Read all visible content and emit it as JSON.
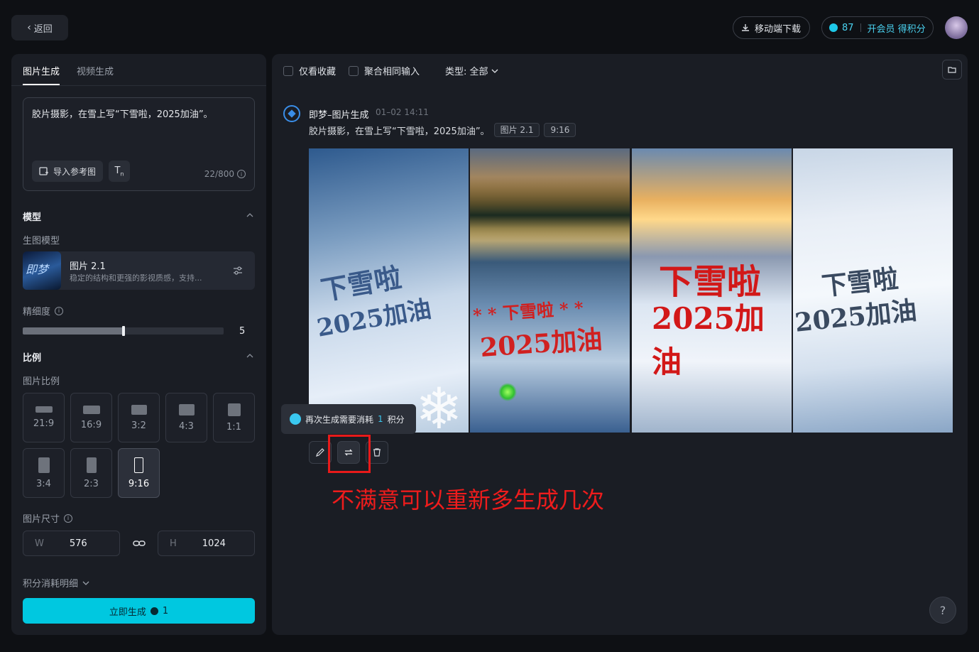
{
  "header": {
    "back_label": "返回",
    "mobile_download_label": "移动端下载",
    "points": "87",
    "member_label": "开会员 得积分"
  },
  "left_panel": {
    "tabs": [
      {
        "label": "图片生成",
        "active": true
      },
      {
        "label": "视频生成",
        "active": false
      }
    ],
    "prompt": "胶片摄影，在雪上写“下雪啦，2025加油”。",
    "import_ref_label": "导入参考图",
    "char_count": "22/800",
    "model_section": {
      "title": "模型",
      "sub_label": "生图模型",
      "model_name": "图片 2.1",
      "model_desc": "稳定的结构和更强的影视质感，支持...",
      "thumb_text": "即梦"
    },
    "detail": {
      "label": "精细度",
      "value": "5",
      "level": 0.5
    },
    "ratio_section": {
      "title": "比例",
      "sub_label": "图片比例",
      "options": [
        {
          "label": "21:9",
          "selected": false
        },
        {
          "label": "16:9",
          "selected": false
        },
        {
          "label": "3:2",
          "selected": false
        },
        {
          "label": "4:3",
          "selected": false
        },
        {
          "label": "1:1",
          "selected": false
        },
        {
          "label": "3:4",
          "selected": false
        },
        {
          "label": "2:3",
          "selected": false
        },
        {
          "label": "9:16",
          "selected": true
        }
      ]
    },
    "size": {
      "label": "图片尺寸",
      "w_label": "W",
      "w_value": "576",
      "h_label": "H",
      "h_value": "1024"
    },
    "points_detail_label": "积分消耗明细",
    "generate_label": "立即生成",
    "generate_cost": "1"
  },
  "right_panel": {
    "filters": {
      "favorites_label": "仅看收藏",
      "merge_label": "聚合相同输入",
      "type_label": "类型: 全部"
    },
    "record": {
      "source": "即梦–图片生成",
      "time": "01–02  14:11",
      "prompt": "胶片摄影，在雪上写“下雪啦，2025加油”。",
      "model_tag": "图片 2.1",
      "ratio_tag": "9:16"
    },
    "images": [
      {
        "line1": "下雪啦",
        "line2": "2025加油"
      },
      {
        "line1": "* * 下雪啦 * *",
        "line2": "2025加油"
      },
      {
        "line1": "下雪啦",
        "line2": "2025加油"
      },
      {
        "line1": "下雪啦",
        "line2": "2025加油"
      }
    ],
    "tooltip": {
      "prefix": "再次生成需要消耗",
      "count": "1",
      "suffix": "积分"
    },
    "annotation": "不满意可以重新多生成几次",
    "help_label": "?"
  },
  "colors": {
    "accent": "#00c8e0",
    "annotation_red": "#ee1c1c"
  }
}
